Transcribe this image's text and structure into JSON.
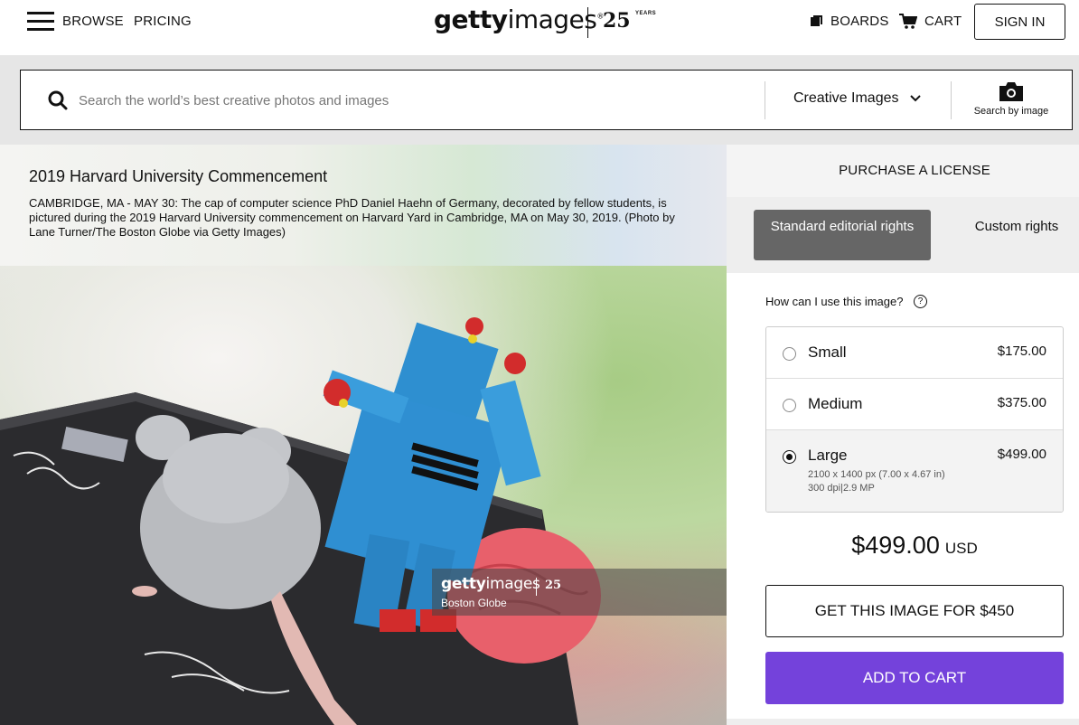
{
  "header": {
    "browse_label": "BROWSE",
    "pricing_label": "PRICING",
    "logo_bold": "getty",
    "logo_light": "images",
    "logo_reg": "®",
    "anniversary_number": "25",
    "anniversary_word": "YEARS",
    "boards_label": "BOARDS",
    "cart_label": "CART",
    "signin_label": "SIGN IN"
  },
  "search": {
    "placeholder": "Search the world’s best creative photos and images",
    "value": "",
    "type_selected": "Creative Images",
    "search_by_image_label": "Search by image"
  },
  "image": {
    "title": "2019 Harvard University Commencement",
    "caption": "CAMBRIDGE, MA - MAY 30: The cap of computer science PhD Daniel Haehn of Germany, decorated by fellow students, is pictured during the 2019 Harvard University commencement on Harvard Yard in Cambridge, MA on May 30, 2019. (Photo by Lane Turner/The Boston Globe via Getty Images)",
    "watermark_bold": "getty",
    "watermark_light": "images",
    "watermark_25": "25",
    "watermark_credit": "Boston Globe"
  },
  "license": {
    "panel_title": "PURCHASE A LICENSE",
    "rights": [
      {
        "label": "Standard editorial rights",
        "active": true
      },
      {
        "label": "Custom rights",
        "active": false
      }
    ],
    "use_question": "How can I use this image?",
    "help_icon_glyph": "?",
    "sizes": [
      {
        "name": "Small",
        "price": "$175.00",
        "selected": false
      },
      {
        "name": "Medium",
        "price": "$375.00",
        "selected": false
      },
      {
        "name": "Large",
        "price": "$499.00",
        "selected": true,
        "detail_line1": "2100 x 1400 px (7.00 x 4.67 in)",
        "detail_line2": "300 dpi|2.9 MP"
      }
    ],
    "total_amount": "$499.00",
    "total_currency": "USD",
    "get_image_label": "GET THIS IMAGE FOR $450",
    "add_to_cart_label": "ADD TO CART"
  },
  "colors": {
    "accent_purple": "#7442db",
    "active_rights_bg": "#666666",
    "search_band_bg": "#e6e6e6"
  },
  "icons": [
    "hamburger-icon",
    "boards-icon",
    "cart-icon",
    "search-icon",
    "chevron-down-icon",
    "camera-icon",
    "help-icon"
  ]
}
